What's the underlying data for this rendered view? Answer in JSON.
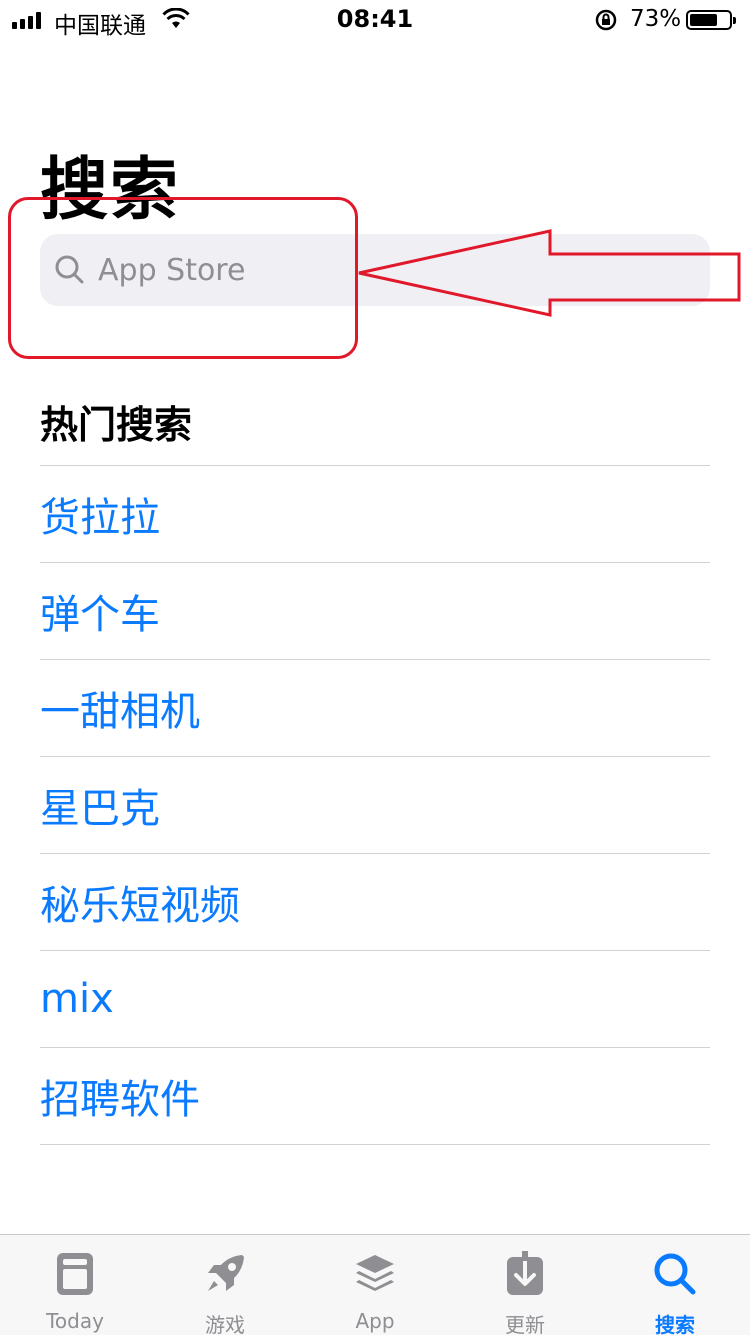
{
  "status_bar": {
    "carrier": "中国联通",
    "time": "08:41",
    "battery_percent": "73%",
    "battery_level": 0.73
  },
  "page": {
    "title": "搜索"
  },
  "search": {
    "placeholder": "App Store"
  },
  "trending": {
    "title": "热门搜索",
    "items": [
      "货拉拉",
      "弹个车",
      "一甜相机",
      "星巴克",
      "秘乐短视频",
      "mix",
      "招聘软件"
    ]
  },
  "tab_bar": {
    "tabs": [
      {
        "label": "Today",
        "icon": "today-icon"
      },
      {
        "label": "游戏",
        "icon": "rocket-icon"
      },
      {
        "label": "App",
        "icon": "apps-stack-icon"
      },
      {
        "label": "更新",
        "icon": "download-icon"
      },
      {
        "label": "搜索",
        "icon": "search-icon",
        "active": true
      }
    ]
  },
  "colors": {
    "accent": "#0a7aff",
    "annotation": "#e0182a",
    "search_bg": "#efeff4",
    "inactive": "#8e8e93"
  }
}
